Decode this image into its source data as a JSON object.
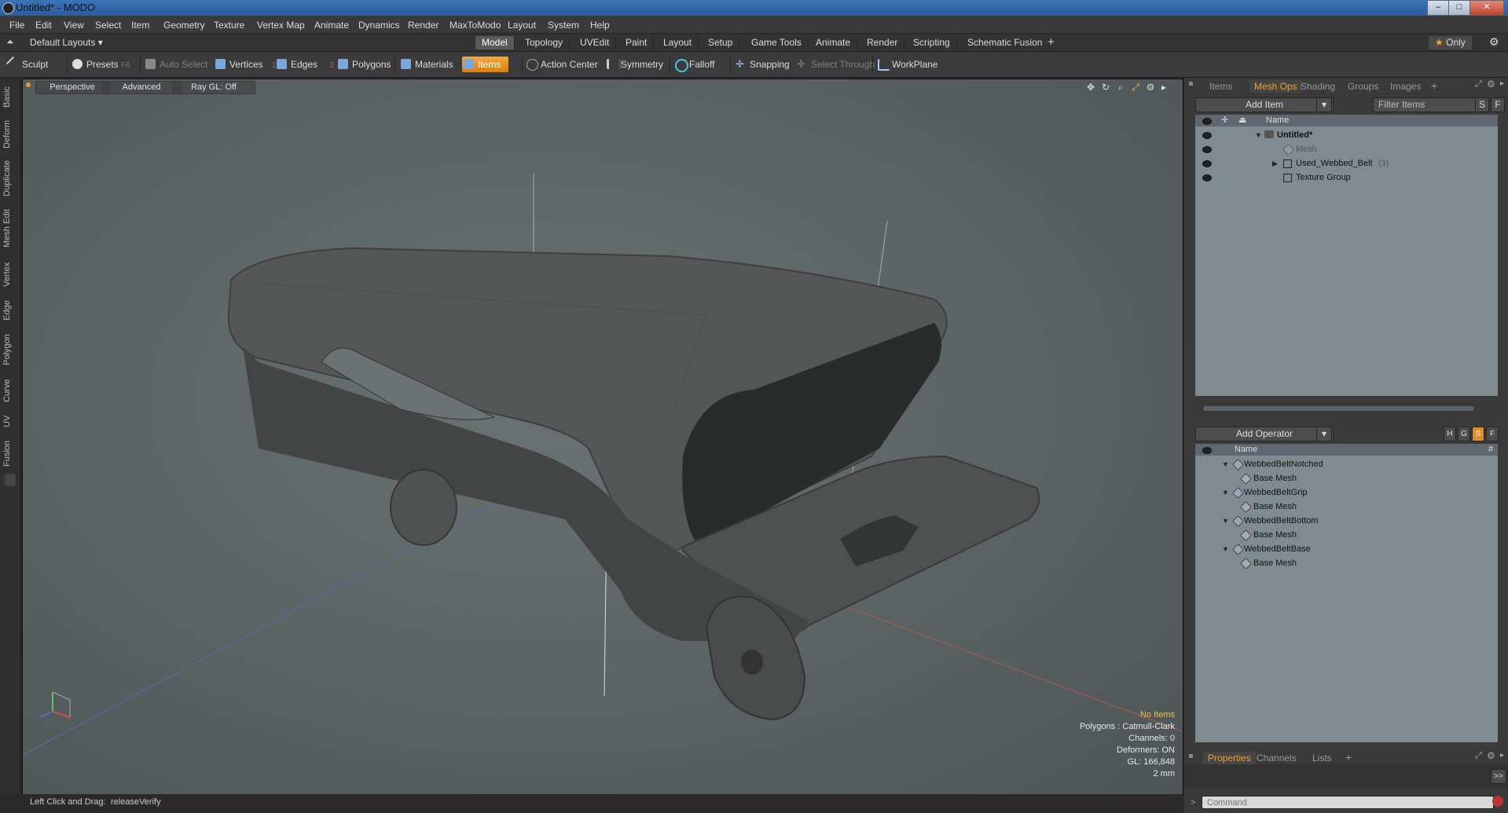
{
  "window": {
    "title": "Untitled* - MODO",
    "buttons": {
      "min": "–",
      "max": "□",
      "close": "✕"
    }
  },
  "menu": [
    "File",
    "Edit",
    "View",
    "Select",
    "Item",
    "Geometry",
    "Texture",
    "Vertex Map",
    "Animate",
    "Dynamics",
    "Render",
    "MaxToModo",
    "Layout",
    "System",
    "Help"
  ],
  "layouts": {
    "selector": "Default Layouts",
    "tabs": [
      "Model",
      "Topology",
      "UVEdit",
      "Paint",
      "Layout",
      "Setup",
      "Game Tools",
      "Animate",
      "Render",
      "Scripting",
      "Schematic Fusion"
    ],
    "active_tab": "Model",
    "add": "+",
    "only_label": "Only"
  },
  "toolbar": {
    "sculpt": "Sculpt",
    "presets": "Presets",
    "presets_key": "F6",
    "auto_select": "Auto Select",
    "vertices": "Vertices",
    "vertices_key": "1",
    "edges": "Edges",
    "edges_key": "2",
    "polygons": "Polygons",
    "materials": "Materials",
    "items": "Items",
    "action_center": "Action Center",
    "symmetry": "Symmetry",
    "falloff": "Falloff",
    "snapping": "Snapping",
    "select_through": "Select Through",
    "workplane": "WorkPlane"
  },
  "left_tabs": [
    "Basic",
    "Deform",
    "Duplicate",
    "Mesh Edit",
    "Vertex",
    "Edge",
    "Polygon",
    "Curve",
    "UV",
    "Fusion"
  ],
  "viewport": {
    "view": "Perspective",
    "shading": "Advanced",
    "raygl": "Ray GL: Off",
    "info": {
      "no_items": "No Items",
      "polygons": "Polygons : Catmull-Clark",
      "channels": "Channels: 0",
      "deformers": "Deformers: ON",
      "gl": "GL: 166,848",
      "size": "2 mm"
    }
  },
  "status": {
    "hint": "Left Click and Drag:",
    "command": "releaseVerify"
  },
  "items_panel": {
    "tabs": [
      "Items",
      "Mesh Ops",
      "Shading",
      "Groups",
      "Images"
    ],
    "active_tab": "Mesh Ops",
    "add": "+",
    "add_item": "Add Item",
    "filter": "Filter Items",
    "s": "S",
    "f": "F",
    "col_name": "Name",
    "tree": [
      {
        "label": "Untitled*",
        "bold": true
      },
      {
        "label": "Mesh",
        "dim": true
      },
      {
        "label": "Used_Webbed_Belt",
        "count": "(3)"
      },
      {
        "label": "Texture Group"
      }
    ]
  },
  "meshops_panel": {
    "add_operator": "Add Operator",
    "col_name": "Name",
    "col_hash": "#",
    "h": "H",
    "g": "G",
    "s": "S",
    "f": "F",
    "ops": [
      {
        "label": "WebbedBeltNotched",
        "child": "Base Mesh"
      },
      {
        "label": "WebbedBeltGrip",
        "child": "Base Mesh"
      },
      {
        "label": "WebbedBeltBottom",
        "child": "Base Mesh"
      },
      {
        "label": "WebbedBeltBase",
        "child": "Base Mesh"
      }
    ]
  },
  "bottom_panel": {
    "tabs": [
      "Properties",
      "Channels",
      "Lists"
    ],
    "active_tab": "Properties",
    "add": "+",
    "expand": ">>",
    "command_placeholder": "Command"
  },
  "colors": {
    "accent": "#f0a030",
    "viewport": "#5c6466",
    "model": "#4a4a4a"
  }
}
